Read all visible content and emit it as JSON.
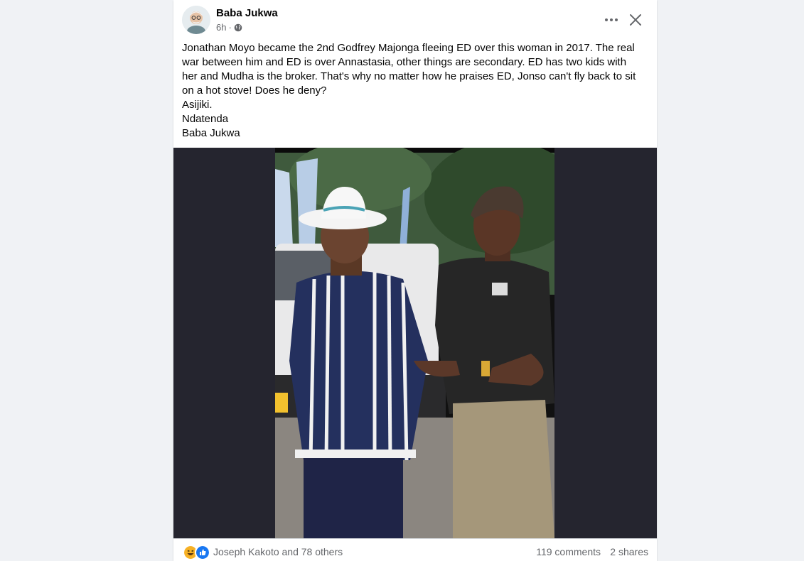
{
  "post": {
    "author": "Baba Jukwa",
    "time": "6h",
    "separator": "·",
    "text_lines": [
      "Jonathan Moyo became the 2nd Godfrey Majonga fleeing ED over this woman in 2017. The real war between him and ED is over Annastasia, other things are secondary. ED has two kids with her and Mudha is the broker. That's why no matter how he praises ED, Jonso can't fly back to sit on a hot stove! Does he deny?",
      "Asijiki.",
      "Ndatenda",
      "Baba Jukwa"
    ],
    "more_icon": "ellipsis-icon",
    "close_icon": "close-icon",
    "privacy_icon": "globe-icon"
  },
  "engagement": {
    "reaction_icons": [
      "haha-icon",
      "like-icon"
    ],
    "reactions_text": "Joseph Kakoto and 78 others",
    "comments": "119 comments",
    "shares": "2 shares"
  },
  "colors": {
    "background": "#f0f2f5",
    "card": "#ffffff",
    "media_bg": "#25252f",
    "muted_text": "#65676b",
    "like_blue": "#1877f2",
    "haha_yellow": "#f7b125"
  }
}
